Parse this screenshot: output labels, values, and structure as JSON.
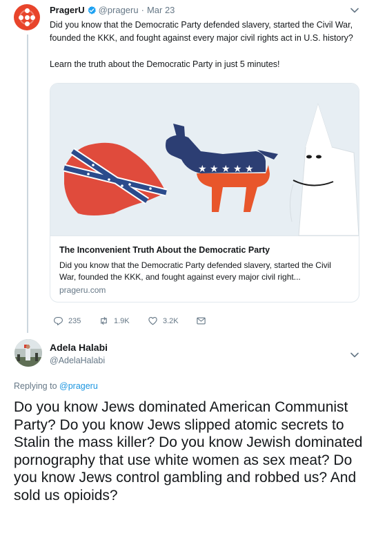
{
  "tweet": {
    "author_name": "PragerU",
    "handle": "@prageru",
    "separator": "·",
    "date": "Mar 23",
    "text_line1": "Did you know that the Democratic Party defended slavery, started the Civil War, founded the KKK, and fought against every major civil rights act in U.S. history?",
    "text_line2": "Learn the truth about the Democratic Party in just 5 minutes!",
    "card": {
      "title": "The Inconvenient Truth About the Democratic Party",
      "description": "Did you know that the Democratic Party defended slavery, started the Civil War, founded the KKK, and fought against every major civil right...",
      "domain": "prageru.com"
    },
    "actions": {
      "replies": "235",
      "retweets": "1.9K",
      "likes": "3.2K"
    }
  },
  "reply": {
    "author_name": "Adela Halabi",
    "handle": "@AdelaHalabi",
    "replying_prefix": "Replying to ",
    "replying_to": "@prageru",
    "text": "Do you know Jews dominated American Communist Party? Do you know Jews  slipped atomic secrets to Stalin the mass killer? Do you know Jewish  dominated pornography that use white women as sex meat? Do you know Jews  control gambling and robbed us? And sold us opioids?"
  },
  "colors": {
    "link": "#1b95e0",
    "muted": "#657786",
    "border": "#e1e8ed",
    "prageru_red": "#e8442b",
    "verified": "#1da1f2"
  },
  "icons": [
    "verified-badge-icon",
    "chevron-down-icon",
    "reply-icon",
    "retweet-icon",
    "like-icon",
    "message-icon"
  ]
}
